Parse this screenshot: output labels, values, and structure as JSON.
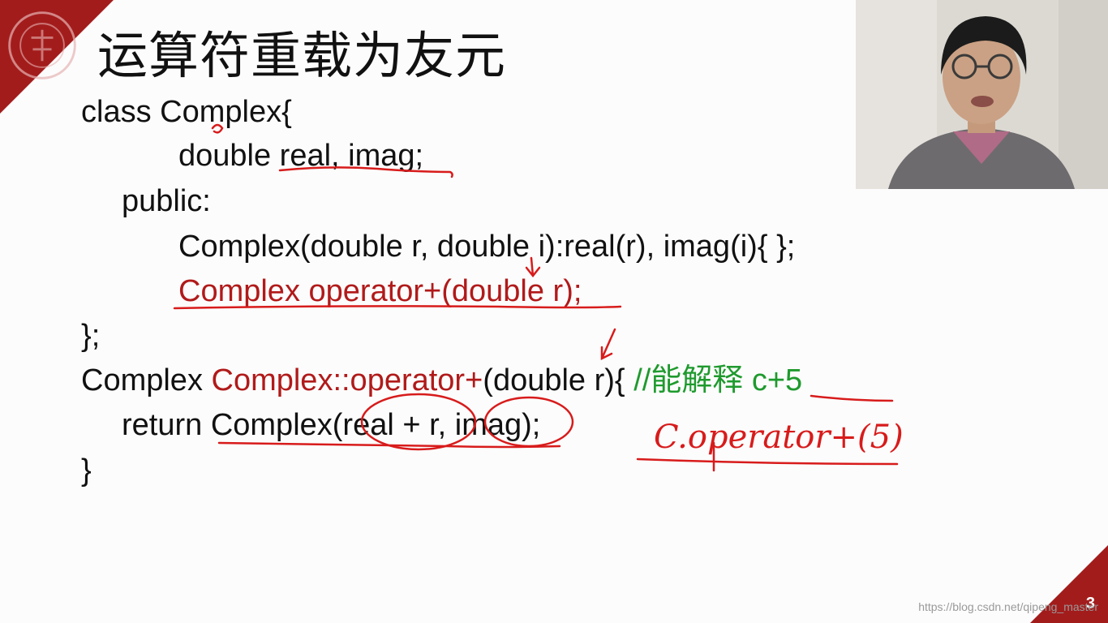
{
  "slide": {
    "title": "运算符重载为友元",
    "page_number": "3",
    "watermark": "https://blog.csdn.net/qipeng_master"
  },
  "code": {
    "line1": "class Complex{",
    "line2": "double real, imag;",
    "line3": "public:",
    "line4": "Complex(double r, double i):real(r), imag(i){ };",
    "line5": "Complex operator+(double r);",
    "line6": "};",
    "line7_a": "Complex ",
    "line7_b": "Complex::operator+",
    "line7_c": "(double r){ ",
    "line7_d": "//能解释 c+5",
    "line8": "return Complex(real + r, imag);",
    "line9": "}"
  },
  "handwriting": {
    "note": "C.operator+(5)"
  },
  "colors": {
    "accent_red": "#a31c1c",
    "code_red": "#b11a1a",
    "comment_green": "#1f9a2e",
    "ink_red": "#d81b1b"
  }
}
